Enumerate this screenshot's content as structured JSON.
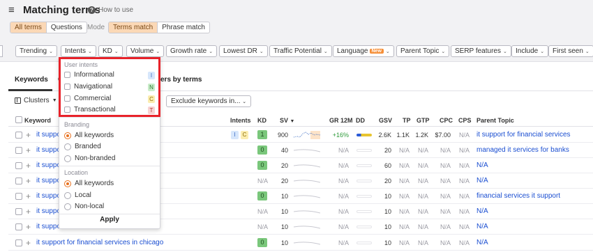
{
  "header": {
    "title": "Matching terms",
    "how_to": "How to use"
  },
  "tabs_top": [
    "All terms",
    "Questions"
  ],
  "mode_label": "Mode",
  "mode_options": [
    "Terms match",
    "Phrase match"
  ],
  "filters": [
    "Trending",
    "Intents",
    "KD",
    "Volume",
    "Growth rate",
    "Lowest DR",
    "Traffic Potential",
    "Language",
    "Parent Topic",
    "SERP features",
    "Include",
    "First seen"
  ],
  "new_badge": "New",
  "view_tabs": {
    "keywords": "Keywords",
    "c_fragment": "C",
    "terms": "ers by terms"
  },
  "clusters_label": "Clusters",
  "exclude_label": "Exclude keywords in...",
  "columns": {
    "keyword": "Keyword",
    "intents": "Intents",
    "kd": "KD",
    "sv": "SV",
    "gr": "GR 12M",
    "dd": "DD",
    "gsv": "GSV",
    "tp": "TP",
    "gtp": "GTP",
    "cpc": "CPC",
    "cps": "CPS",
    "parent": "Parent Topic"
  },
  "rows": [
    {
      "kw": "it suppo",
      "frag": "",
      "intents": [
        "I",
        "C"
      ],
      "kd": "1",
      "sv": "900",
      "gr": "+16%",
      "gsv": "2.6K",
      "tp": "1.1K",
      "gtp": "1.2K",
      "cpc": "$7.00",
      "cps": "N/A",
      "parent": "it support for financial services"
    },
    {
      "kw": "it suppo",
      "frag": "",
      "intents": [],
      "kd": "0",
      "sv": "40",
      "gr": "N/A",
      "gsv": "20",
      "tp": "N/A",
      "gtp": "N/A",
      "cpc": "N/A",
      "cps": "N/A",
      "parent": "managed it services for banks"
    },
    {
      "kw": "it suppo",
      "frag": "",
      "intents": [],
      "kd": "0",
      "sv": "20",
      "gr": "N/A",
      "gsv": "60",
      "tp": "N/A",
      "gtp": "N/A",
      "cpc": "N/A",
      "cps": "N/A",
      "parent": "N/A"
    },
    {
      "kw": "it suppo",
      "frag": "s",
      "intents": [],
      "kd": "N/A",
      "sv": "20",
      "gr": "N/A",
      "gsv": "20",
      "tp": "N/A",
      "gtp": "N/A",
      "cpc": "N/A",
      "cps": "N/A",
      "parent": "N/A"
    },
    {
      "kw": "it suppo",
      "frag": "",
      "intents": [],
      "kd": "0",
      "sv": "10",
      "gr": "N/A",
      "gsv": "10",
      "tp": "N/A",
      "gtp": "N/A",
      "cpc": "N/A",
      "cps": "N/A",
      "parent": "financial services it support"
    },
    {
      "kw": "it suppo",
      "frag": "",
      "intents": [],
      "kd": "N/A",
      "sv": "10",
      "gr": "N/A",
      "gsv": "10",
      "tp": "N/A",
      "gtp": "N/A",
      "cpc": "N/A",
      "cps": "N/A",
      "parent": "N/A"
    },
    {
      "kw": "it suppo",
      "frag": "",
      "intents": [],
      "kd": "N/A",
      "sv": "10",
      "gr": "N/A",
      "gsv": "10",
      "tp": "N/A",
      "gtp": "N/A",
      "cpc": "N/A",
      "cps": "N/A",
      "parent": "N/A"
    },
    {
      "kw": "it support for financial services in chicago",
      "frag": "",
      "intents": [],
      "kd": "0",
      "sv": "10",
      "gr": "N/A",
      "gsv": "10",
      "tp": "N/A",
      "gtp": "N/A",
      "cpc": "N/A",
      "cps": "N/A",
      "parent": "N/A"
    }
  ],
  "dropdown": {
    "user_intents_title": "User intents",
    "intents": [
      {
        "label": "Informational",
        "letter": "I",
        "color": "#d6e6fb",
        "text": "#3a6bc2"
      },
      {
        "label": "Navigational",
        "letter": "N",
        "color": "#c9ecc9",
        "text": "#2f7a31"
      },
      {
        "label": "Commercial",
        "letter": "C",
        "color": "#fbedb0",
        "text": "#8a6a00"
      },
      {
        "label": "Transactional",
        "letter": "T",
        "color": "#f8d3d3",
        "text": "#b23a3a"
      }
    ],
    "branding_title": "Branding",
    "branding": [
      "All keywords",
      "Branded",
      "Non-branded"
    ],
    "location_title": "Location",
    "location": [
      "All keywords",
      "Local",
      "Non-local"
    ],
    "apply": "Apply"
  },
  "colors": {
    "accent_orange": "#f58f38",
    "highlight_red": "#e8222a",
    "link_blue": "#1a4ed1",
    "kd_green": "#7ac77b"
  }
}
